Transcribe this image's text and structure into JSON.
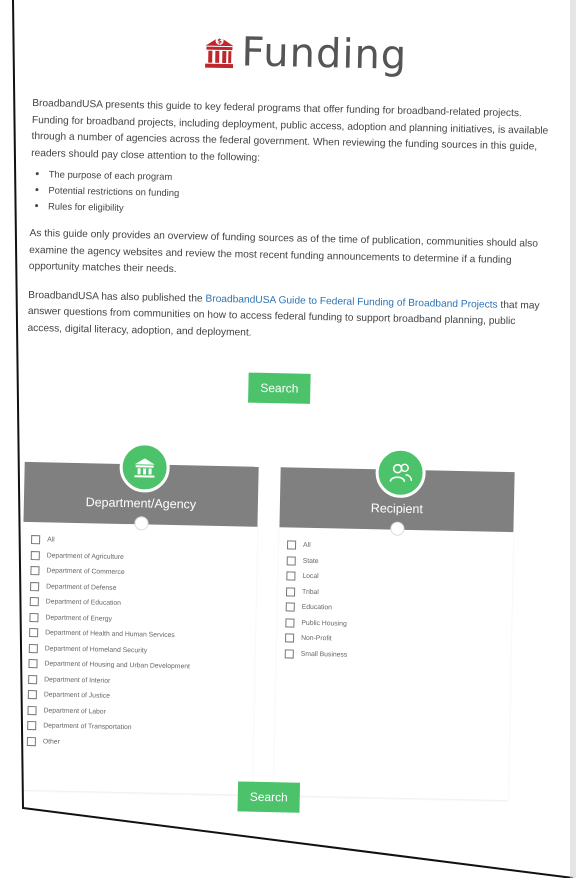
{
  "header": {
    "title": "Funding",
    "icon": "building-dollar-icon"
  },
  "intro": {
    "paragraph1": "BroadbandUSA presents this guide to key federal programs that offer funding for broadband-related projects. Funding for broadband projects, including deployment, public access, adoption and planning initiatives, is available through a number of agencies across the federal government. When reviewing the funding sources in this guide, readers should pay close attention to the following:",
    "bullets": [
      "The purpose of each program",
      "Potential restrictions on funding",
      "Rules for eligibility"
    ],
    "paragraph2": "As this guide only provides an overview of funding sources as of the time of publication, communities should also examine the agency websites and review the most recent funding announcements to determine if a funding opportunity matches their needs.",
    "paragraph3_start": "BroadbandUSA has also published the ",
    "paragraph3_link": "BroadbandUSA Guide to Federal Funding of Broadband Projects",
    "paragraph3_end": " that may answer questions from communities on how to access federal funding to support broadband planning, public access, digital literacy, adoption, and deployment."
  },
  "search_label": "Search",
  "department_panel": {
    "title": "Department/Agency",
    "icon": "building-icon",
    "options": [
      "All",
      "Department of Agriculture",
      "Department of Commerce",
      "Department of Defense",
      "Department of Education",
      "Department of Energy",
      "Department of Health and Human Services",
      "Department of Homeland Security",
      "Department of Housing and Urban Development",
      "Department of Interior",
      "Department of Justice",
      "Department of Labor",
      "Department of Transportation",
      "Other"
    ]
  },
  "recipient_panel": {
    "title": "Recipient",
    "icon": "people-icon",
    "options": [
      "All",
      "State",
      "Local",
      "Tribal",
      "Education",
      "Public Housing",
      "Non-Profit",
      "Small Business"
    ]
  },
  "colors": {
    "accent": "#4cc36a",
    "header_gray": "#808080",
    "brand_red": "#c0272d",
    "link": "#2e74b5"
  }
}
